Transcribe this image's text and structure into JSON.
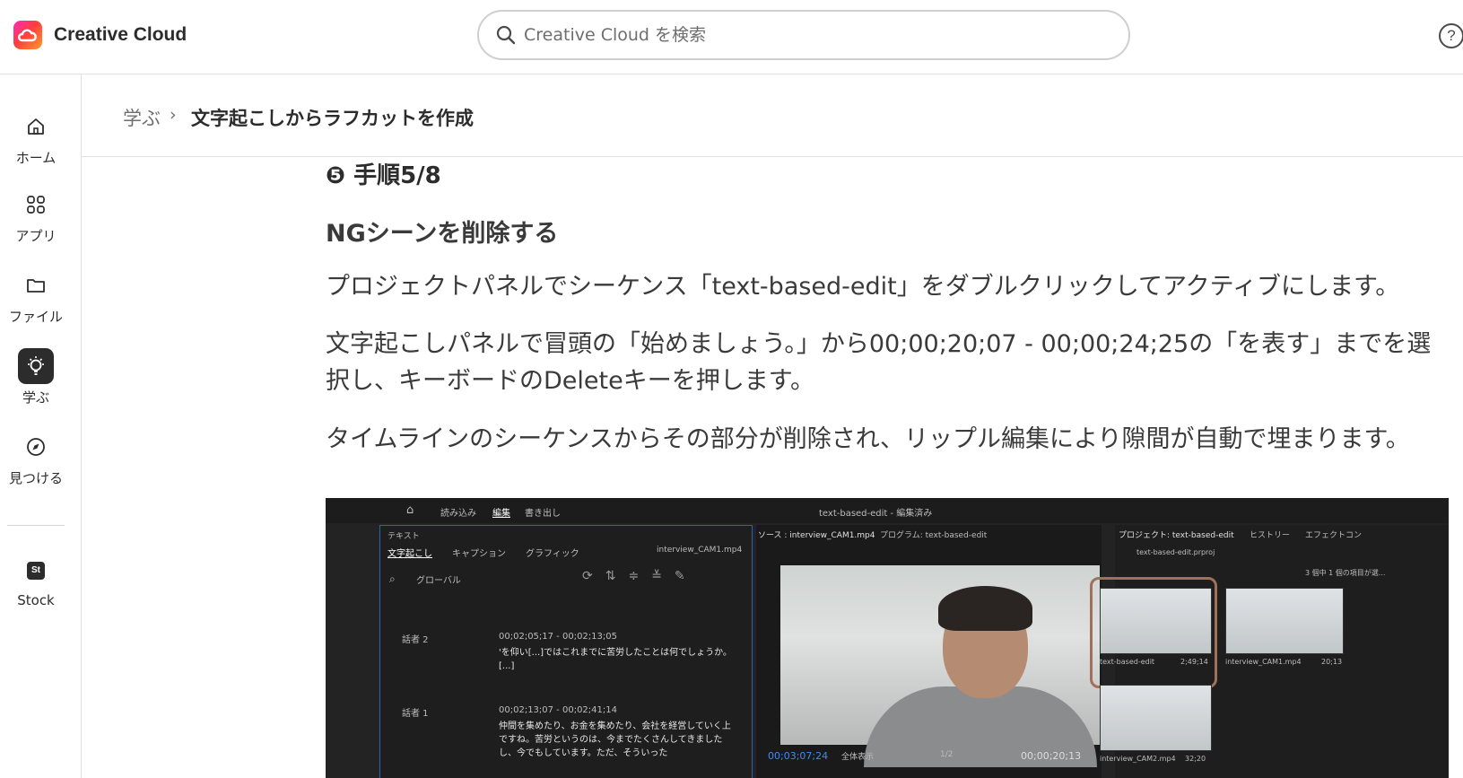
{
  "header": {
    "app_title": "Creative Cloud",
    "search_placeholder": "Creative Cloud を検索",
    "help_label": "?"
  },
  "sidebar": {
    "items": [
      {
        "label": "ホーム",
        "icon": "home-icon"
      },
      {
        "label": "アプリ",
        "icon": "apps-grid-icon"
      },
      {
        "label": "ファイル",
        "icon": "folder-icon"
      },
      {
        "label": "学ぶ",
        "icon": "lightbulb-icon",
        "active": true
      },
      {
        "label": "見つける",
        "icon": "compass-icon"
      },
      {
        "label": "Stock",
        "icon": "stock-icon",
        "badge": "St"
      }
    ]
  },
  "breadcrumb": {
    "root": "学ぶ",
    "separator": "›",
    "current": "文字起こしからラフカットを作成"
  },
  "article": {
    "step_title": "❺ 手順5/8",
    "section_title": "NGシーンを削除する",
    "paragraphs": [
      "プロジェクトパネルでシーケンス「text-based-edit」をダブルクリックしてアクティブにします。",
      "文字起こしパネルで冒頭の「始めましょう。」から00;00;20;07 - 00;00;24;25の「を表す」までを選択し、キーボードのDeleteキーを押します。",
      "タイムラインのシーケンスからその部分が削除され、リップル編集により隙間が自動で埋まります。"
    ]
  },
  "figure": {
    "menu": {
      "import": "読み込み",
      "edit": "編集",
      "export": "書き出し",
      "title": "text-based-edit - 編集済み"
    },
    "text_panel": {
      "title": "テキスト",
      "tabs": [
        "文字起こし",
        "キャプション",
        "グラフィック"
      ],
      "file": "interview_CAM1.mp4",
      "search_value": "グローバル",
      "entries": [
        {
          "speaker": "話者 2",
          "time": "00;02;05;17 - 00;02;13;05",
          "text": "'を仰い[...]ではこれまでに苦労したことは何でしょうか。[...]"
        },
        {
          "speaker": "話者 1",
          "time": "00;02;13;07 - 00;02;41;14",
          "text": "仲間を集めたり、お金を集めたり、会社を経営していく上ですね。苦労というのは、今までたくさんしてきましたし、今でもしています。ただ、そういった"
        }
      ]
    },
    "monitor": {
      "source_tab": "ソース : interview_CAM1.mp4",
      "program_tab": "プログラム: text-based-edit",
      "timecode_left": "00;03;07;24",
      "zoom": "全体表示",
      "resolution": "1/2",
      "timecode_right": "00;00;20;13"
    },
    "project_panel": {
      "title": "プロジェクト: text-based-edit",
      "tabs": [
        "ヒストリー",
        "エフェクトコン"
      ],
      "file": "text-based-edit.prproj",
      "status": "3 個中 1 個の項目が選...",
      "items": [
        {
          "name": "text-based-edit",
          "duration": "2;49;14"
        },
        {
          "name": "interview_CAM1.mp4",
          "duration": "20;13"
        },
        {
          "name": "interview_CAM2.mp4",
          "duration": "32;20"
        }
      ]
    }
  }
}
